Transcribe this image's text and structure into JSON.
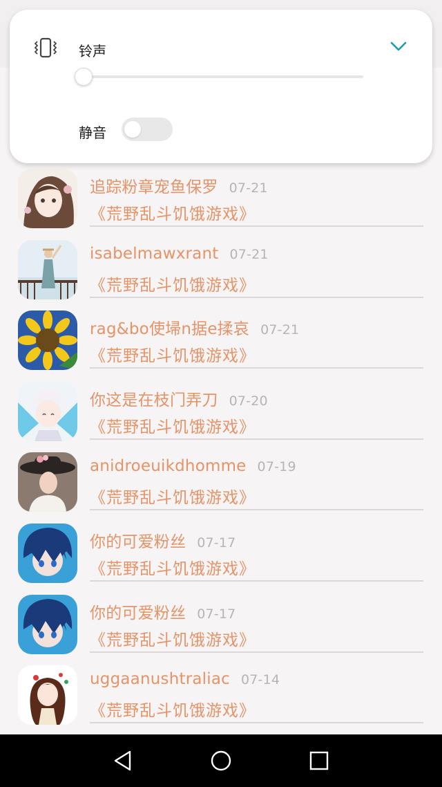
{
  "volume_panel": {
    "title": "铃声",
    "mute_label": "静音",
    "mute_enabled": false,
    "ringtone_volume_fraction": 0.0,
    "accent_color": "#1a9ab0",
    "icons": [
      "vibrate-icon",
      "chevron-down-icon"
    ]
  },
  "messages": [
    {
      "name": "追踪粉章宠鱼保罗",
      "date": "07-21",
      "game": "《荒野乱斗饥饿游戏》"
    },
    {
      "name": "isabelmawxrant",
      "date": "07-21",
      "game": "《荒野乱斗饥饿游戏》"
    },
    {
      "name": "rag&bo使埽n据e揉哀",
      "date": "07-21",
      "game": "《荒野乱斗饥饿游戏》"
    },
    {
      "name": "你这是在枝门弄刀",
      "date": "07-20",
      "game": "《荒野乱斗饥饿游戏》"
    },
    {
      "name": "anidroeuikdhomme",
      "date": "07-19",
      "game": "《荒野乱斗饥饿游戏》"
    },
    {
      "name": "你的可爱粉丝",
      "date": "07-17",
      "game": "《荒野乱斗饥饿游戏》"
    },
    {
      "name": "你的可爱粉丝",
      "date": "07-17",
      "game": "《荒野乱斗饥饿游戏》"
    },
    {
      "name": "uggaanushtraliac",
      "date": "07-14",
      "game": "《荒野乱斗饥饿游戏》"
    }
  ],
  "colors": {
    "name_text": "#e69367",
    "date_text": "#b9b3b3",
    "background": "#f7f4f5"
  },
  "navigation_bar": {
    "icons": [
      "back-icon",
      "home-icon",
      "recents-icon"
    ]
  }
}
